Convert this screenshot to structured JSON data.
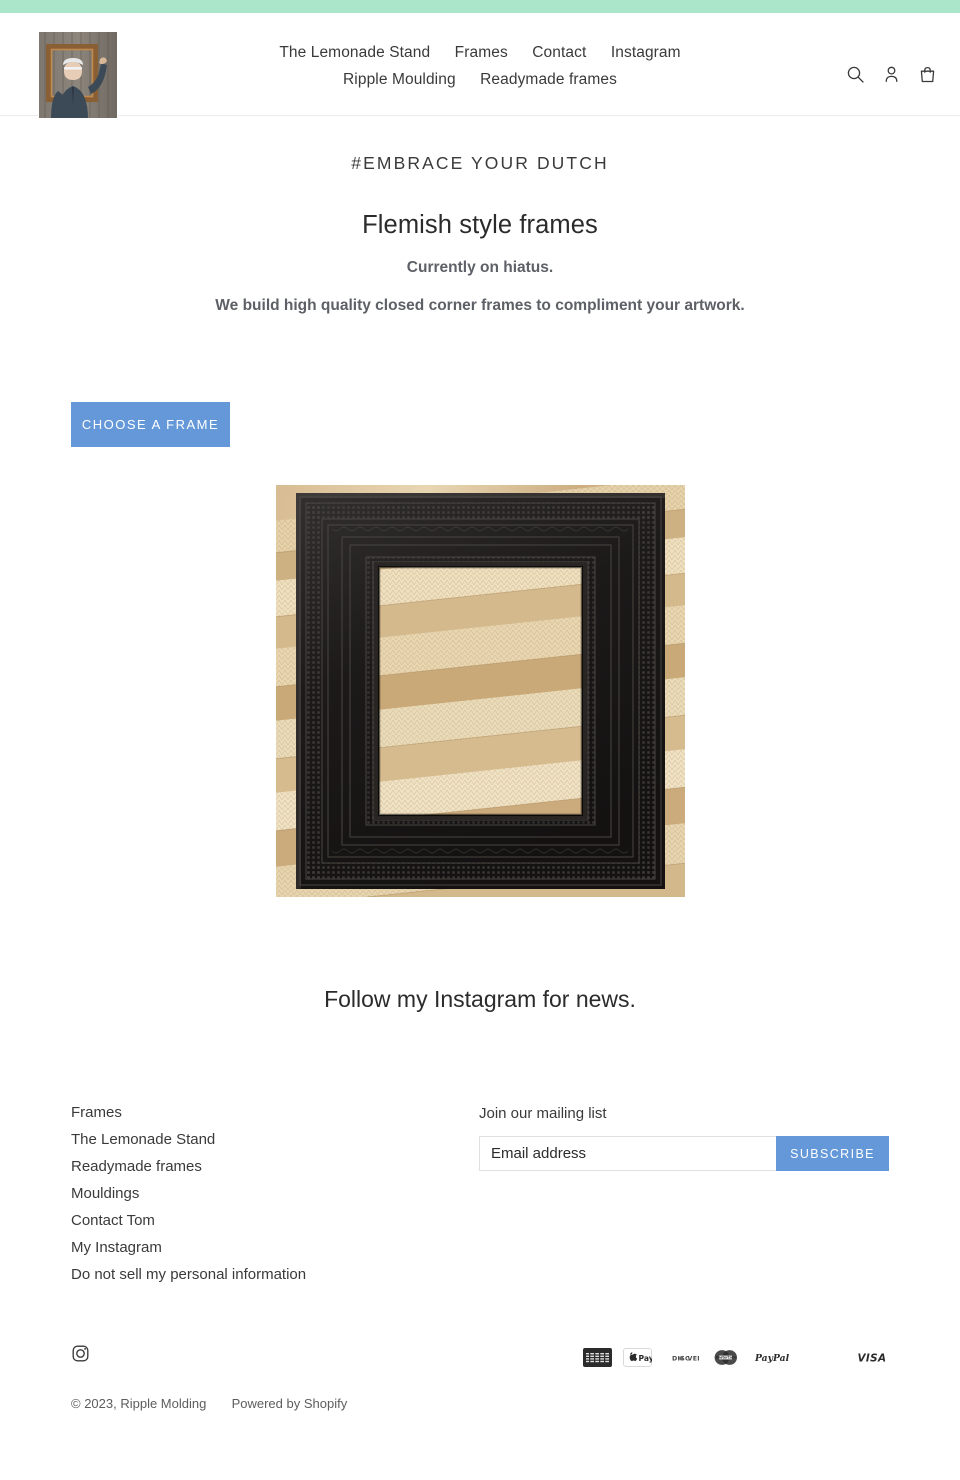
{
  "announcement": {
    "text": "",
    "bg_color": "#abe5ca"
  },
  "header": {
    "logo": {
      "alt": "Ripple Molding",
      "icon": "logo-photo-man-holding-frame"
    },
    "nav_row1": [
      {
        "label": "The Lemonade Stand"
      },
      {
        "label": "Frames"
      },
      {
        "label": "Contact"
      },
      {
        "label": "Instagram"
      }
    ],
    "nav_row2": [
      {
        "label": "Ripple Moulding"
      },
      {
        "label": "Readymade frames"
      }
    ],
    "icons": [
      {
        "name": "search-icon",
        "label": "Search"
      },
      {
        "name": "account-icon",
        "label": "Log in"
      },
      {
        "name": "cart-icon",
        "label": "Cart"
      }
    ]
  },
  "hero": {
    "kicker": "#EMBRACE YOUR DUTCH",
    "title": "Flemish style frames",
    "subtitle1": "Currently on hiatus.",
    "subtitle2": "We build high quality closed corner frames to compliment your artwork.",
    "cta_label": "CHOOSE A FRAME",
    "cta_color": "#6498d8",
    "image_alt": "Black Flemish ripple frame resting on stacked ripple mouldings"
  },
  "instagram_section": {
    "heading": "Follow my Instagram for news."
  },
  "footer": {
    "menu": [
      {
        "label": "Frames"
      },
      {
        "label": "The Lemonade Stand"
      },
      {
        "label": "Readymade frames"
      },
      {
        "label": "Mouldings"
      },
      {
        "label": "Contact Tom"
      },
      {
        "label": "My Instagram"
      },
      {
        "label": "Do not sell my personal information"
      }
    ],
    "newsletter": {
      "title": "Join our mailing list",
      "placeholder": "Email address",
      "value": "",
      "submit_label": "SUBSCRIBE",
      "submit_color": "#6498d8"
    },
    "social": [
      {
        "name": "instagram-icon",
        "label": "Instagram"
      }
    ],
    "payment_methods": [
      {
        "name": "american-express",
        "label": "American Express"
      },
      {
        "name": "apple-pay",
        "label": "Apple Pay"
      },
      {
        "name": "discover",
        "label": "Discover"
      },
      {
        "name": "mastercard",
        "label": "Mastercard"
      },
      {
        "name": "paypal",
        "label": "PayPal"
      },
      {
        "name": "visa",
        "label": "Visa"
      }
    ],
    "copyright": "© 2023, Ripple Molding",
    "powered_by": "Powered by Shopify"
  }
}
